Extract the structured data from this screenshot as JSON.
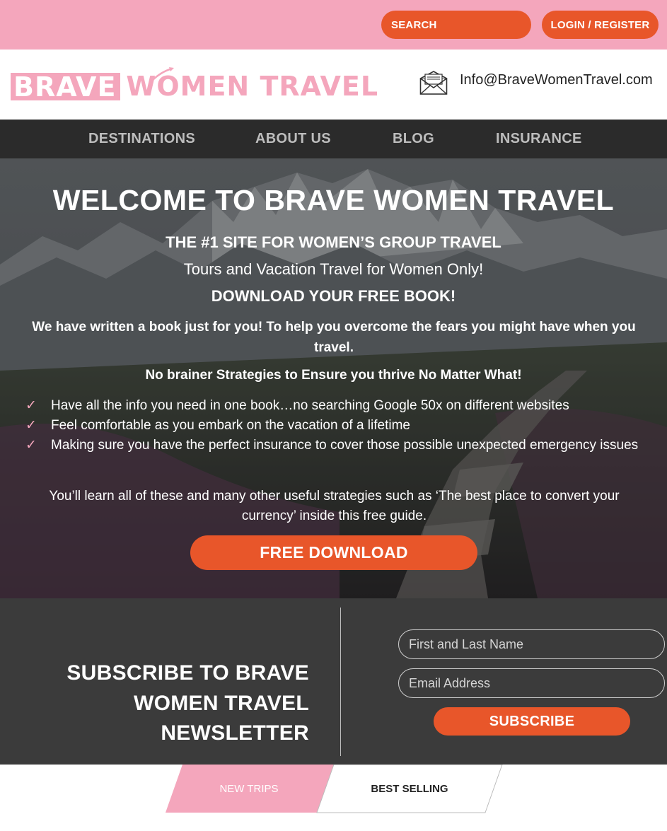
{
  "topbar": {
    "search_label": "SEARCH",
    "login_label": "LOGIN / REGISTER"
  },
  "header": {
    "logo": {
      "word1": "BRAVE",
      "word2": "WOMEN TRAVEL"
    },
    "email": "Info@BraveWomenTravel.com",
    "mail_icon": "envelope-icon"
  },
  "nav": {
    "items": [
      {
        "label": "DESTINATIONS"
      },
      {
        "label": "ABOUT US"
      },
      {
        "label": "BLOG"
      },
      {
        "label": "INSURANCE"
      }
    ]
  },
  "hero": {
    "title": "WELCOME TO BRAVE WOMEN TRAVEL",
    "subtitle": "THE #1 SITE FOR WOMEN’S GROUP TRAVEL",
    "tagline": "Tours and Vacation Travel for Women Only!",
    "download_heading": "DOWNLOAD YOUR FREE BOOK!",
    "intro": "We have written a book just for you!  To help you overcome the fears you might have when you travel.",
    "strategies_heading": "No brainer Strategies to Ensure you thrive No Matter What!",
    "checklist": [
      "Have all the info you need in one book…no  searching Google 50x on different websites",
      "Feel comfortable as you embark on the vacation of a lifetime",
      "Making sure you have the perfect insurance to cover those possible unexpected emergency issues"
    ],
    "check_glyph": "✓",
    "learn_text": "You’ll learn all of these and many other useful strategies such as ‘The best place to convert your currency’ inside this free guide.",
    "cta_label": "FREE DOWNLOAD"
  },
  "newsletter": {
    "title": "SUBSCRIBE TO BRAVE WOMEN TRAVEL NEWSLETTER",
    "name_placeholder": "First and Last Name",
    "email_placeholder": "Email Address",
    "subscribe_label": "SUBSCRIBE"
  },
  "tabs": [
    {
      "label": "NEW TRIPS",
      "active": true
    },
    {
      "label": "BEST SELLING",
      "active": false
    }
  ],
  "colors": {
    "pink": "#f4a6bc",
    "orange": "#e8562a",
    "nav_dark": "#2b2b2b",
    "newsletter_bg": "#3b3b3b"
  }
}
